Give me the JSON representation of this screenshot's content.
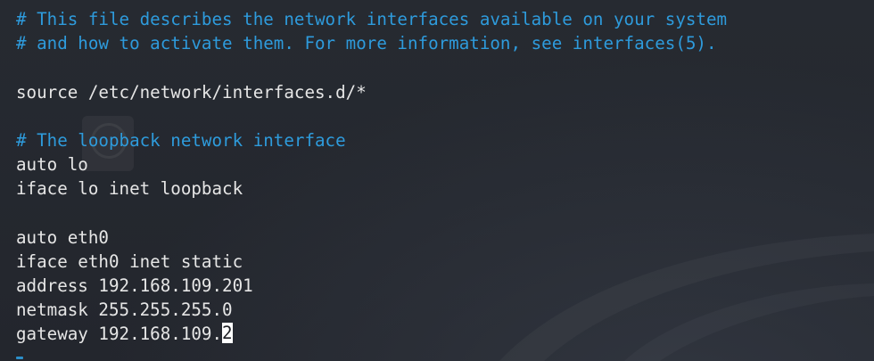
{
  "editor": {
    "lines": [
      {
        "type": "comment",
        "text": "# This file describes the network interfaces available on your system"
      },
      {
        "type": "comment",
        "text": "# and how to activate them. For more information, see interfaces(5)."
      },
      {
        "type": "blank",
        "text": ""
      },
      {
        "type": "code",
        "text": "source /etc/network/interfaces.d/*"
      },
      {
        "type": "blank",
        "text": ""
      },
      {
        "type": "comment",
        "text": "# The loopback network interface"
      },
      {
        "type": "code",
        "text": "auto lo"
      },
      {
        "type": "code",
        "text": "iface lo inet loopback"
      },
      {
        "type": "blank",
        "text": ""
      },
      {
        "type": "code",
        "text": "auto eth0"
      },
      {
        "type": "code",
        "text": "iface eth0 inet static"
      },
      {
        "type": "code",
        "text": "address 192.168.109.201"
      },
      {
        "type": "code",
        "text": "netmask 255.255.255.0"
      },
      {
        "type": "code",
        "text": "gateway 192.168.109.",
        "cursor_char": "2"
      }
    ]
  },
  "colors": {
    "comment": "#2e9bdc",
    "text": "#e6e6e6",
    "background": "#23262d",
    "cursor_bg": "#ffffff"
  }
}
